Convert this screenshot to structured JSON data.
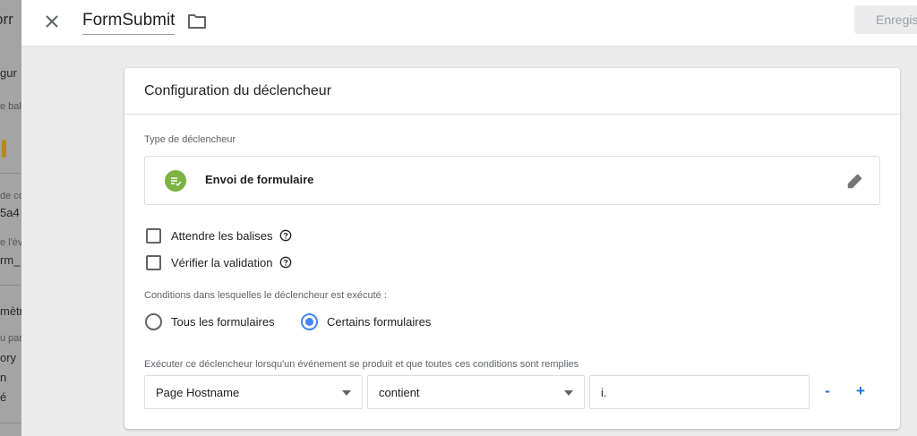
{
  "background": {
    "fragments": [
      "orr",
      "gur",
      "e bal",
      "de co",
      "5a4 -",
      "e l'év",
      "rm_",
      "mètre",
      "u par",
      "ory",
      "n",
      "é"
    ]
  },
  "topbar": {
    "close_icon": "close-icon",
    "title": "FormSubmit",
    "folder_icon": "folder-icon",
    "save_label": "Enregistrer"
  },
  "card": {
    "header": "Configuration du déclencheur",
    "trigger_type_label": "Type de déclencheur",
    "trigger_type": {
      "icon": "form-check-icon",
      "name": "Envoi de formulaire",
      "edit_icon": "edit-pencil-icon"
    },
    "checkboxes": [
      {
        "label": "Attendre les balises",
        "checked": false
      },
      {
        "label": "Vérifier la validation",
        "checked": false
      }
    ],
    "conditions_label": "Conditions dans lesquelles le déclencheur est exécuté :",
    "radios": [
      {
        "label": "Tous les formulaires",
        "selected": false
      },
      {
        "label": "Certains formulaires",
        "selected": true
      }
    ],
    "filter_label": "Exécuter ce déclencheur lorsqu'un événement se produit et que toutes ces conditions sont remplies",
    "filter": {
      "variable": "Page Hostname",
      "operator": "contient",
      "value": "i.",
      "remove_label": "-",
      "add_label": "+"
    }
  },
  "colors": {
    "accent": "#4285f4",
    "trigger_icon_bg": "#7cb342",
    "link_blue": "#1a73e8"
  }
}
